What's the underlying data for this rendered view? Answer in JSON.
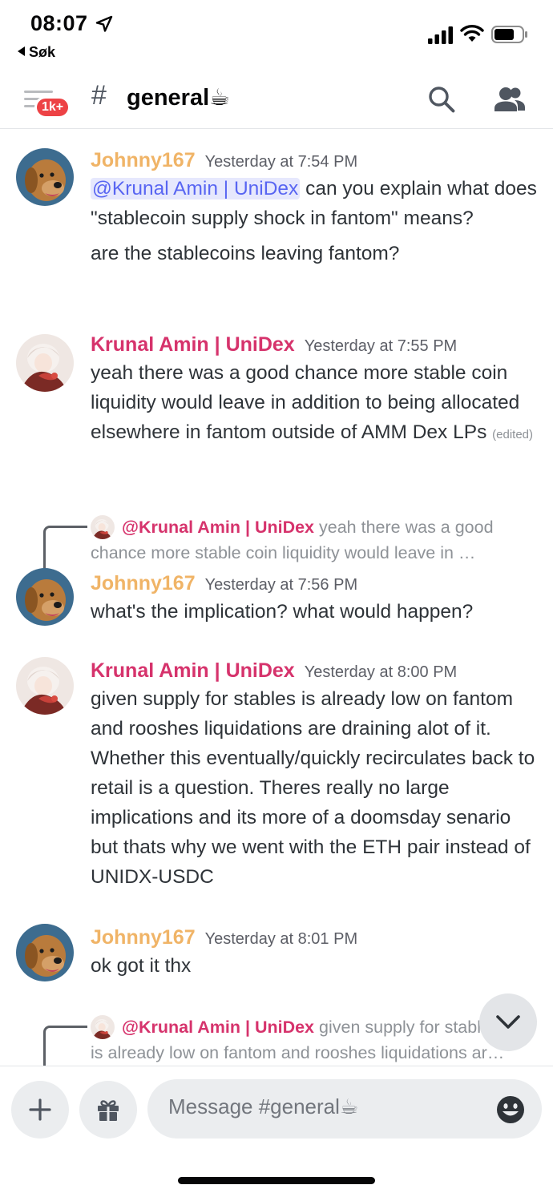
{
  "status_bar": {
    "time": "08:07",
    "back_app": "Søk"
  },
  "header": {
    "unread_badge": "1k+",
    "hash": "#",
    "channel_name": "general☕"
  },
  "messages": [
    {
      "author": "Johnny167",
      "timestamp": "Yesterday at 7:54 PM",
      "mention": "@Krunal Amin | UniDex",
      "text_after_mention": " can you explain what does \"stablecoin supply shock in fantom\" means?",
      "text2": "are the stablecoins leaving fantom?"
    },
    {
      "author": "Krunal Amin | UniDex",
      "timestamp": "Yesterday at 7:55 PM",
      "text": "yeah there was a good chance more stable coin liquidity would leave in addition to being allocated elsewhere in fantom outside of AMM Dex LPs",
      "edited": "(edited)"
    },
    {
      "reply_to": {
        "name": "@Krunal Amin | UniDex",
        "snippet_1": "yeah there was a good",
        "snippet_2": "chance more stable coin liquidity would leave in …"
      },
      "author": "Johnny167",
      "timestamp": "Yesterday at 7:56 PM",
      "text": "what's the implication? what would happen?"
    },
    {
      "author": "Krunal Amin | UniDex",
      "timestamp": "Yesterday at 8:00 PM",
      "text": "given supply for stables is already low on fantom and rooshes liquidations are draining alot of it. Whether this eventually/quickly recirculates back to retail is a question. Theres really no large implications and its more of a doomsday senario but thats why we went with the ETH pair instead of UNIDX-USDC"
    },
    {
      "author": "Johnny167",
      "timestamp": "Yesterday at 8:01 PM",
      "text": "ok got it thx"
    }
  ],
  "pending_reply": {
    "name": "@Krunal Amin | UniDex",
    "snippet_1": "given supply for stables",
    "snippet_2": "is already low on fantom and rooshes liquidations ar…"
  },
  "composer": {
    "placeholder": "Message #general☕"
  },
  "colors": {
    "johnny": "#f0b467",
    "krunal": "#d6336c",
    "mention_bg": "#e6e8fd",
    "mention_fg": "#5865f2",
    "badge": "#ed4245"
  }
}
